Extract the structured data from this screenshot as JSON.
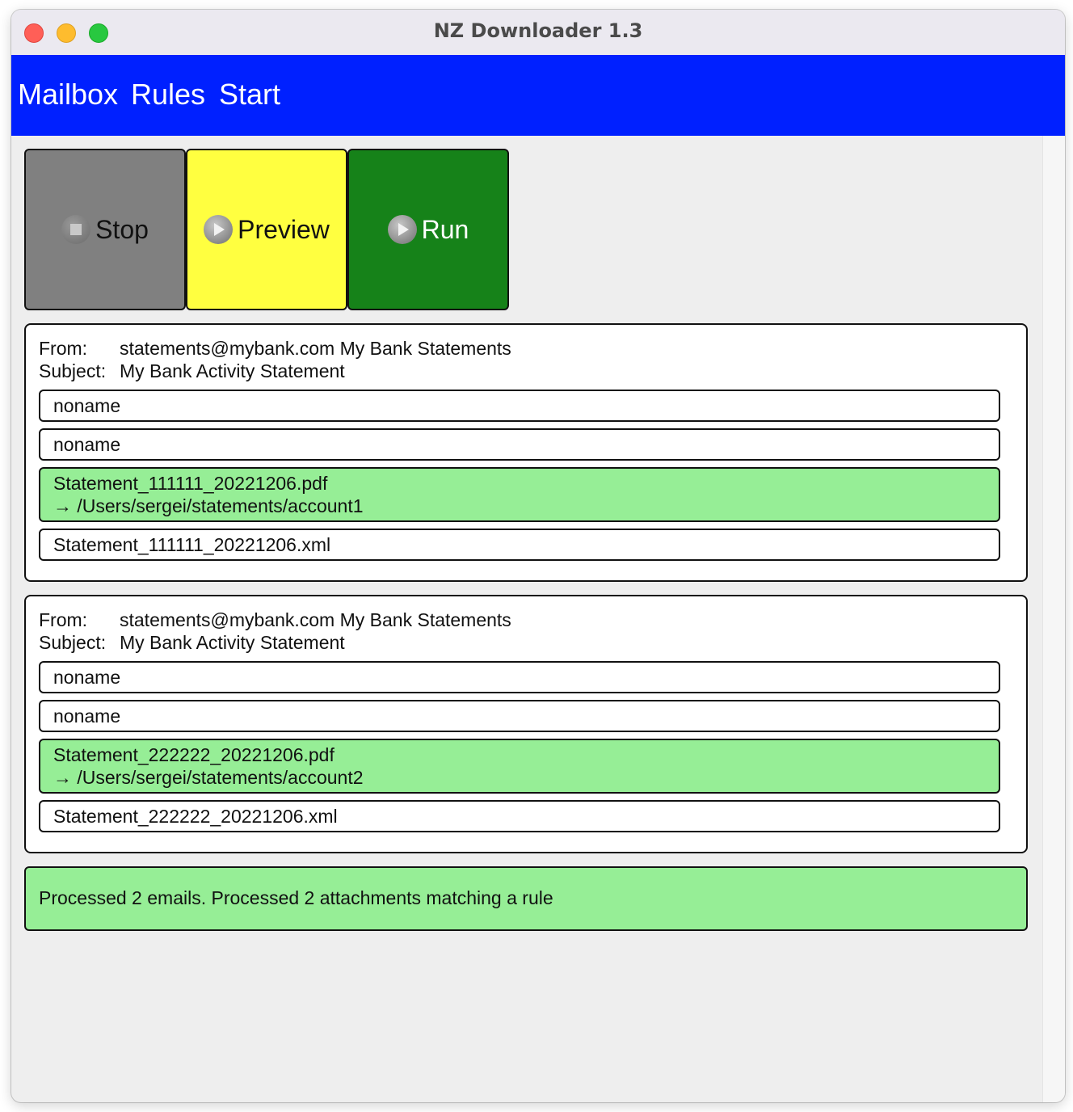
{
  "window": {
    "title": "NZ Downloader 1.3"
  },
  "menu": {
    "items": [
      "Mailbox",
      "Rules",
      "Start"
    ]
  },
  "toolbar": {
    "stop_label": "Stop",
    "preview_label": "Preview",
    "run_label": "Run"
  },
  "labels": {
    "from": "From:",
    "subject": "Subject:"
  },
  "emails": [
    {
      "from": "statements@mybank.com My Bank Statements",
      "subject": "My Bank Activity Statement",
      "attachments": [
        {
          "name": "noname",
          "matched": false
        },
        {
          "name": "noname",
          "matched": false
        },
        {
          "name": "Statement_111111_20221206.pdf",
          "destination": "→ /Users/sergei/statements/account1",
          "matched": true
        },
        {
          "name": "Statement_111111_20221206.xml",
          "matched": false
        }
      ]
    },
    {
      "from": "statements@mybank.com My Bank Statements",
      "subject": "My Bank Activity Statement",
      "attachments": [
        {
          "name": "noname",
          "matched": false
        },
        {
          "name": "noname",
          "matched": false
        },
        {
          "name": "Statement_222222_20221206.pdf",
          "destination": "→ /Users/sergei/statements/account2",
          "matched": true
        },
        {
          "name": "Statement_222222_20221206.xml",
          "matched": false
        }
      ]
    }
  ],
  "status": {
    "message": "Processed 2 emails. Processed 2 attachments matching a rule"
  },
  "colors": {
    "menubar": "#0020ff",
    "stop": "#808080",
    "preview": "#ffff40",
    "run": "#168219",
    "matched": "#96ee96"
  },
  "icons": {
    "stop": "stop-icon",
    "preview": "play-icon",
    "run": "play-icon"
  }
}
